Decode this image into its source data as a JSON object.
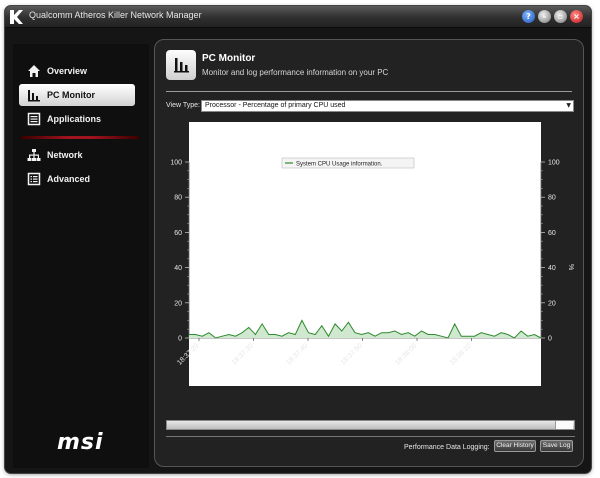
{
  "window": {
    "title": "Qualcomm Atheros Killer Network Manager",
    "buttons": [
      "help",
      "minimize",
      "restore",
      "close"
    ]
  },
  "sidebar": {
    "items": [
      {
        "label": "Overview",
        "icon": "home-icon",
        "active": false
      },
      {
        "label": "PC Monitor",
        "icon": "bar-chart-icon",
        "active": true
      },
      {
        "label": "Applications",
        "icon": "window-list-icon",
        "active": false
      },
      {
        "label": "Network",
        "icon": "network-tree-icon",
        "active": false
      },
      {
        "label": "Advanced",
        "icon": "settings-list-icon",
        "active": false
      }
    ],
    "brand": "msi"
  },
  "header": {
    "title": "PC Monitor",
    "subtitle": "Monitor and log performance information on your PC"
  },
  "view_type": {
    "label": "View Type:",
    "selected": "Processor - Percentage of primary CPU used"
  },
  "chart_data": {
    "type": "area",
    "legend": [
      "System CPU Usage information."
    ],
    "legend_placement": "top-center",
    "ylabel_right": "%",
    "ylim": [
      0,
      110
    ],
    "yticks": [
      0,
      20,
      40,
      60,
      80,
      100
    ],
    "x_ticks": [
      "18:37:20",
      "18:37:30",
      "18:37:40",
      "18:37:50",
      "18:38:00",
      "18:38:10"
    ],
    "grid": false,
    "series": [
      {
        "name": "System CPU Usage information.",
        "color": "#2d8a2d",
        "fill": "#cfe8cf",
        "values": [
          2,
          2,
          1,
          3,
          0,
          1,
          2,
          1,
          3,
          6,
          2,
          8,
          2,
          2,
          1,
          3,
          2,
          10,
          3,
          2,
          7,
          1,
          8,
          4,
          9,
          3,
          2,
          3,
          1,
          3,
          3,
          4,
          2,
          3,
          1,
          4,
          2,
          2,
          1,
          0,
          8,
          1,
          1,
          1,
          3,
          2,
          1,
          3,
          2,
          0,
          4,
          1,
          2,
          0
        ]
      }
    ]
  },
  "footer": {
    "logging_label": "Performance Data Logging:",
    "clear_history": "Clear History",
    "save_log": "Save Log"
  },
  "colors": {
    "accent_red": "#a0141e",
    "series_green": "#2d8a2d"
  }
}
